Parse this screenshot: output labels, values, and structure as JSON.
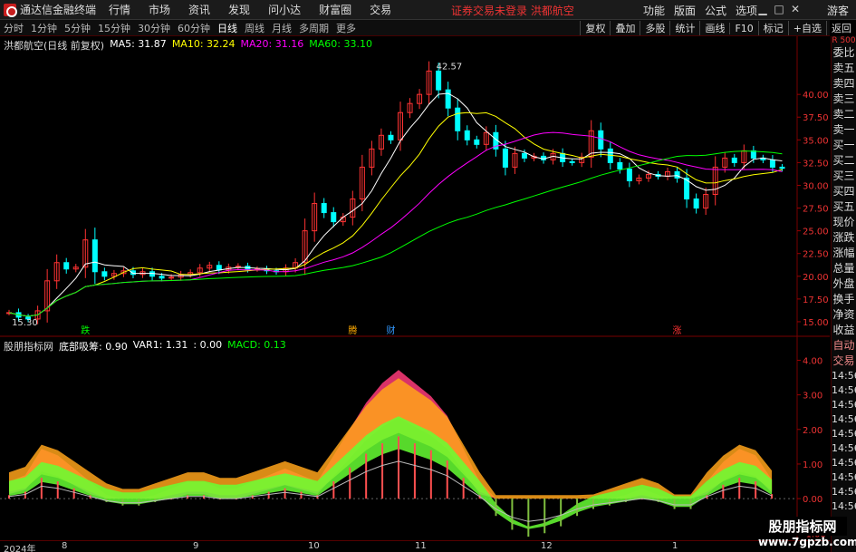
{
  "titlebar": {
    "app_title": "通达信金融终端",
    "menu": [
      "行情",
      "市场",
      "资讯",
      "发现",
      "问小达",
      "财富圈",
      "交易"
    ],
    "login_warning": "证券交易未登录  洪都航空",
    "right_menu": [
      "功能",
      "版面",
      "公式",
      "选项"
    ],
    "guest": "游客"
  },
  "periods": [
    "分时",
    "1分钟",
    "5分钟",
    "15分钟",
    "30分钟",
    "60分钟",
    "日线",
    "周线",
    "月线",
    "多周期",
    "更多"
  ],
  "active_period": "日线",
  "toolbar_right": [
    "复权",
    "叠加",
    "多股",
    "统计",
    "画线",
    "F10",
    "标记",
    "+自选",
    "返回"
  ],
  "main_legend": {
    "stock": "洪都航空(日线 前复权)",
    "ma5": "MA5: 31.87",
    "ma10": "MA10: 32.24",
    "ma20": "MA20: 31.16",
    "ma60": "MA60: 33.10"
  },
  "indicator_legend": {
    "name": "股朋指标网",
    "dibu": "底部吸筹: 0.90",
    "var1": "VAR1: 1.31",
    "var2": ": 0.00",
    "macd": "MACD: 0.13"
  },
  "colors": {
    "ma5": "#ffffff",
    "ma10": "#ffff00",
    "ma20": "#ff00ff",
    "ma60": "#00ff00",
    "up": "#ff3333",
    "down": "#00ffff"
  },
  "annotations": {
    "high": "42.57",
    "low": "15.30",
    "mark1": "跌",
    "mark2": "腾",
    "mark3": "财",
    "mark4": "涨"
  },
  "side_panel": {
    "top": "R 500",
    "items": [
      "委比",
      "卖五",
      "卖四",
      "卖三",
      "卖二",
      "卖一",
      "买一",
      "买二",
      "买三",
      "买四",
      "买五",
      "现价",
      "涨跌",
      "涨幅",
      "总量",
      "外盘",
      "换手",
      "净资",
      "收益"
    ],
    "auto": [
      "自动",
      "交易"
    ],
    "times": [
      "14:56",
      "14:56",
      "14:56",
      "14:56",
      "14:56",
      "14:56",
      "14:56",
      "14:56",
      "14:56",
      "14:56"
    ]
  },
  "x_axis": [
    "2024年",
    "8",
    "9",
    "10",
    "11",
    "12",
    "1"
  ],
  "watermark": {
    "line1": "股朋指标网",
    "line2": "www.7gpzb.com"
  },
  "chart_data": [
    {
      "type": "candlestick",
      "ylim": [
        15,
        42.57
      ],
      "y_ticks": [
        15,
        17.5,
        20,
        22.5,
        25,
        27.5,
        30,
        32.5,
        35,
        37.5,
        40
      ],
      "close": [
        16.0,
        15.5,
        15.3,
        16.2,
        19.5,
        21.5,
        20.8,
        21.0,
        24.0,
        20.5,
        20.0,
        20.3,
        20.6,
        20.2,
        20.5,
        20.0,
        19.8,
        19.9,
        20.2,
        20.4,
        20.9,
        21.2,
        20.7,
        21.0,
        21.1,
        20.8,
        20.8,
        20.6,
        20.5,
        20.9,
        21.5,
        25.0,
        28.0,
        27.0,
        26.0,
        26.5,
        28.5,
        32.0,
        34.0,
        35.5,
        35.0,
        38.0,
        39.0,
        40.0,
        42.57,
        40.5,
        38.5,
        36.0,
        35.0,
        34.5,
        35.8,
        34.0,
        32.0,
        33.5,
        33.0,
        33.2,
        32.8,
        33.5,
        32.6,
        32.5,
        33.1,
        36.0,
        34.0,
        32.5,
        31.8,
        30.5,
        30.8,
        31.2,
        31.0,
        31.5,
        30.8,
        28.5,
        27.5,
        29.0,
        32.0,
        33.0,
        32.5,
        33.8,
        33.0,
        32.8,
        32.0,
        31.87
      ],
      "ma5_last": 31.87,
      "ma10_last": 32.24,
      "ma20_last": 31.16,
      "ma60_last": 33.1
    },
    {
      "type": "indicator",
      "ylim": [
        -1.0,
        4.0
      ],
      "y_ticks": [
        -1.0,
        0.0,
        1.0,
        2.0,
        3.0,
        4.0
      ],
      "macd": [
        0.1,
        0.2,
        0.6,
        0.5,
        0.3,
        0.1,
        -0.1,
        -0.2,
        -0.2,
        -0.1,
        0.0,
        0.1,
        0.1,
        0.0,
        0.0,
        0.1,
        0.2,
        0.3,
        0.2,
        0.1,
        0.5,
        0.9,
        1.3,
        1.6,
        1.8,
        1.6,
        1.4,
        1.1,
        0.6,
        0.1,
        -0.5,
        -0.9,
        -1.1,
        -1.0,
        -0.8,
        -0.5,
        -0.3,
        -0.2,
        -0.1,
        0.0,
        -0.1,
        -0.3,
        -0.3,
        0.1,
        0.4,
        0.6,
        0.5,
        0.13
      ]
    }
  ]
}
